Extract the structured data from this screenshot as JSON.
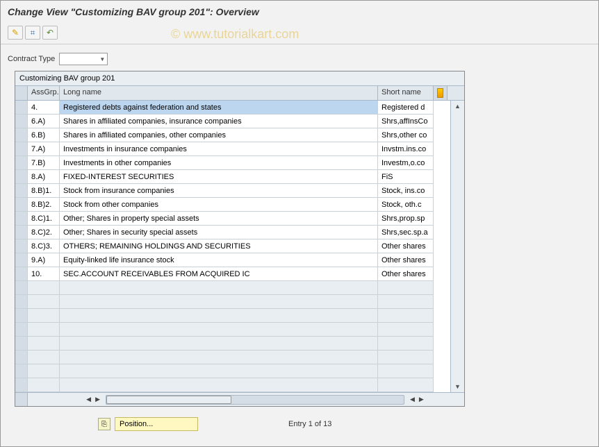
{
  "header": {
    "title": "Change View \"Customizing BAV group 201\": Overview"
  },
  "toolbar": {
    "icons": [
      "pencil-icon",
      "glasses-icon",
      "window-icon"
    ]
  },
  "filter": {
    "label": "Contract Type"
  },
  "table": {
    "title": "Customizing BAV group 201",
    "columns": {
      "assgrp": "AssGrp...",
      "long": "Long name",
      "short": "Short name"
    },
    "rows": [
      {
        "ass": "4.",
        "long": "Registered debts against federation and states",
        "short": "Registered d",
        "hl": true
      },
      {
        "ass": "6.A)",
        "long": "Shares in affiliated companies, insurance companies",
        "short": "Shrs,affInsCo"
      },
      {
        "ass": "6.B)",
        "long": "Shares in affiliated companies, other companies",
        "short": "Shrs,other co"
      },
      {
        "ass": "7.A)",
        "long": "Investments in insurance companies",
        "short": "Invstm.ins.co"
      },
      {
        "ass": "7.B)",
        "long": "Investments in other companies",
        "short": "Investm,o.co"
      },
      {
        "ass": "8.A)",
        "long": "FIXED-INTEREST SECURITIES",
        "short": "FiS"
      },
      {
        "ass": "8.B)1.",
        "long": "Stock from insurance companies",
        "short": "Stock, ins.co"
      },
      {
        "ass": "8.B)2.",
        "long": "Stock from other companies",
        "short": "Stock, oth.c"
      },
      {
        "ass": "8.C)1.",
        "long": "Other; Shares in property special assets",
        "short": "Shrs,prop.sp"
      },
      {
        "ass": "8.C)2.",
        "long": "Other; Shares in security special assets",
        "short": "Shrs,sec.sp.a"
      },
      {
        "ass": "8.C)3.",
        "long": "OTHERS; REMAINING HOLDINGS AND SECURITIES",
        "short": "Other shares"
      },
      {
        "ass": "9.A)",
        "long": "Equity-linked life insurance stock",
        "short": "Other shares"
      },
      {
        "ass": "10.",
        "long": "SEC.ACCOUNT RECEIVABLES FROM ACQUIRED IC",
        "short": "Other shares"
      }
    ]
  },
  "footer": {
    "position_label": "Position...",
    "entry_text": "Entry 1 of 13"
  },
  "watermark": "© www.tutorialkart.com"
}
